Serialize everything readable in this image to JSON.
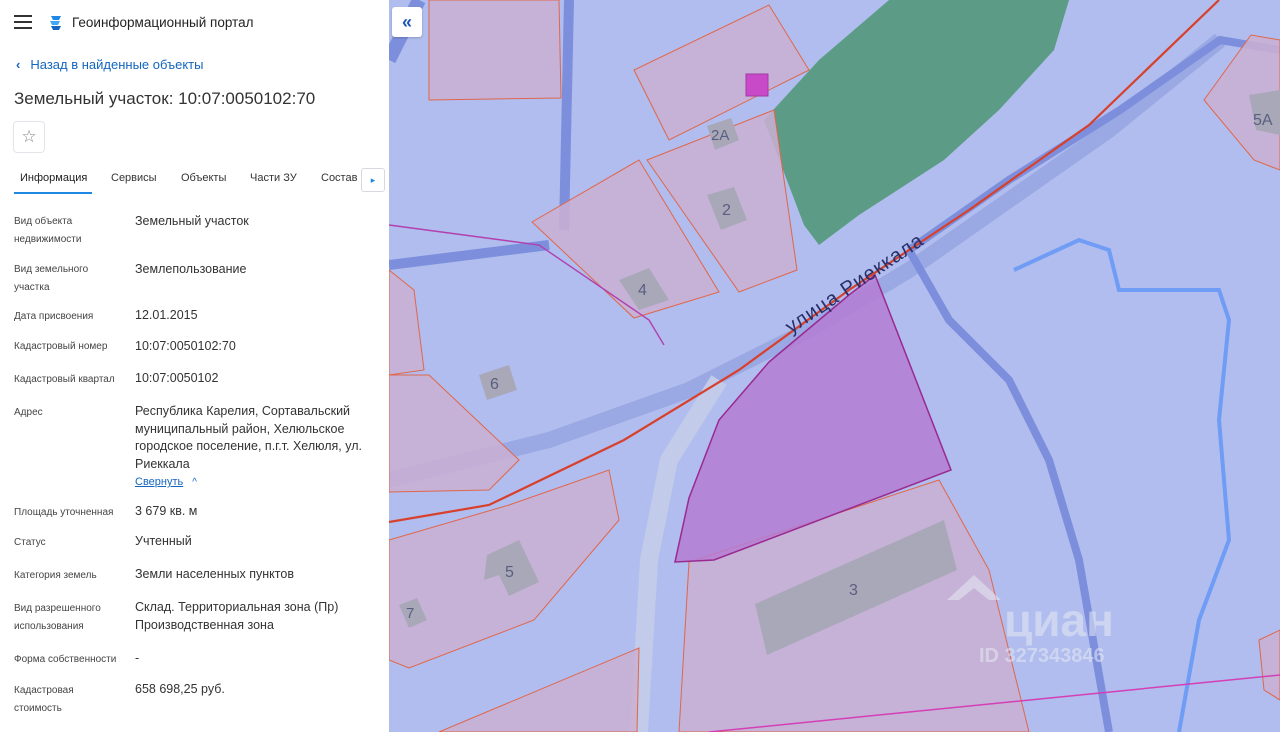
{
  "header": {
    "app_title": "Геоинформационный портал"
  },
  "back_link": "Назад в найденные объекты",
  "title": "Земельный участок: 10:07:0050102:70",
  "favorite_icon": "☆",
  "tabs": [
    "Информация",
    "Сервисы",
    "Объекты",
    "Части ЗУ",
    "Состав"
  ],
  "tab_scroll_icon": "▸",
  "info": [
    {
      "label": "Вид объекта недвижимости",
      "value": "Земельный участок"
    },
    {
      "label": "Вид земельного участка",
      "value": "Землепользование"
    },
    {
      "label": "Дата присвоения",
      "value": "12.01.2015"
    },
    {
      "label": "Кадастровый номер",
      "value": "10:07:0050102:70"
    },
    {
      "label": "Кадастровый квартал",
      "value": "10:07:0050102"
    },
    {
      "label": "Адрес",
      "value": "Республика Карелия, Сортавальский муниципальный район, Хелюльское городское поселение, п.г.т. Хелюля, ул. Риеккала"
    },
    {
      "label": "Площадь уточненная",
      "value": "3 679 кв. м"
    },
    {
      "label": "Статус",
      "value": "Учтенный"
    },
    {
      "label": "Категория земель",
      "value": "Земли населенных пунктов"
    },
    {
      "label": "Вид разрешенного использования",
      "value": "Склад. Территориальная зона (Пр) Производственная зона"
    },
    {
      "label": "Форма собственности",
      "value": "-"
    },
    {
      "label": "Кадастровая стоимость",
      "value": "658 698,25 руб."
    }
  ],
  "collapse_link": "Свернуть",
  "map": {
    "collapse_icon": "«",
    "street_label": "улица Риеккала",
    "building_numbers": [
      "2А",
      "2",
      "4",
      "6",
      "5",
      "7",
      "3",
      "5А"
    ],
    "watermark": {
      "brand": "циан",
      "id": "ID 327343846"
    },
    "colors": {
      "background": "#b0bdee",
      "parcel_fill": "#cab0d2",
      "parcel_border": "#e0664a",
      "selected_parcel": "#b47dd4",
      "forest": "#5c9c86",
      "road": "#7d8fdc",
      "street_line": "#d8402b"
    }
  }
}
